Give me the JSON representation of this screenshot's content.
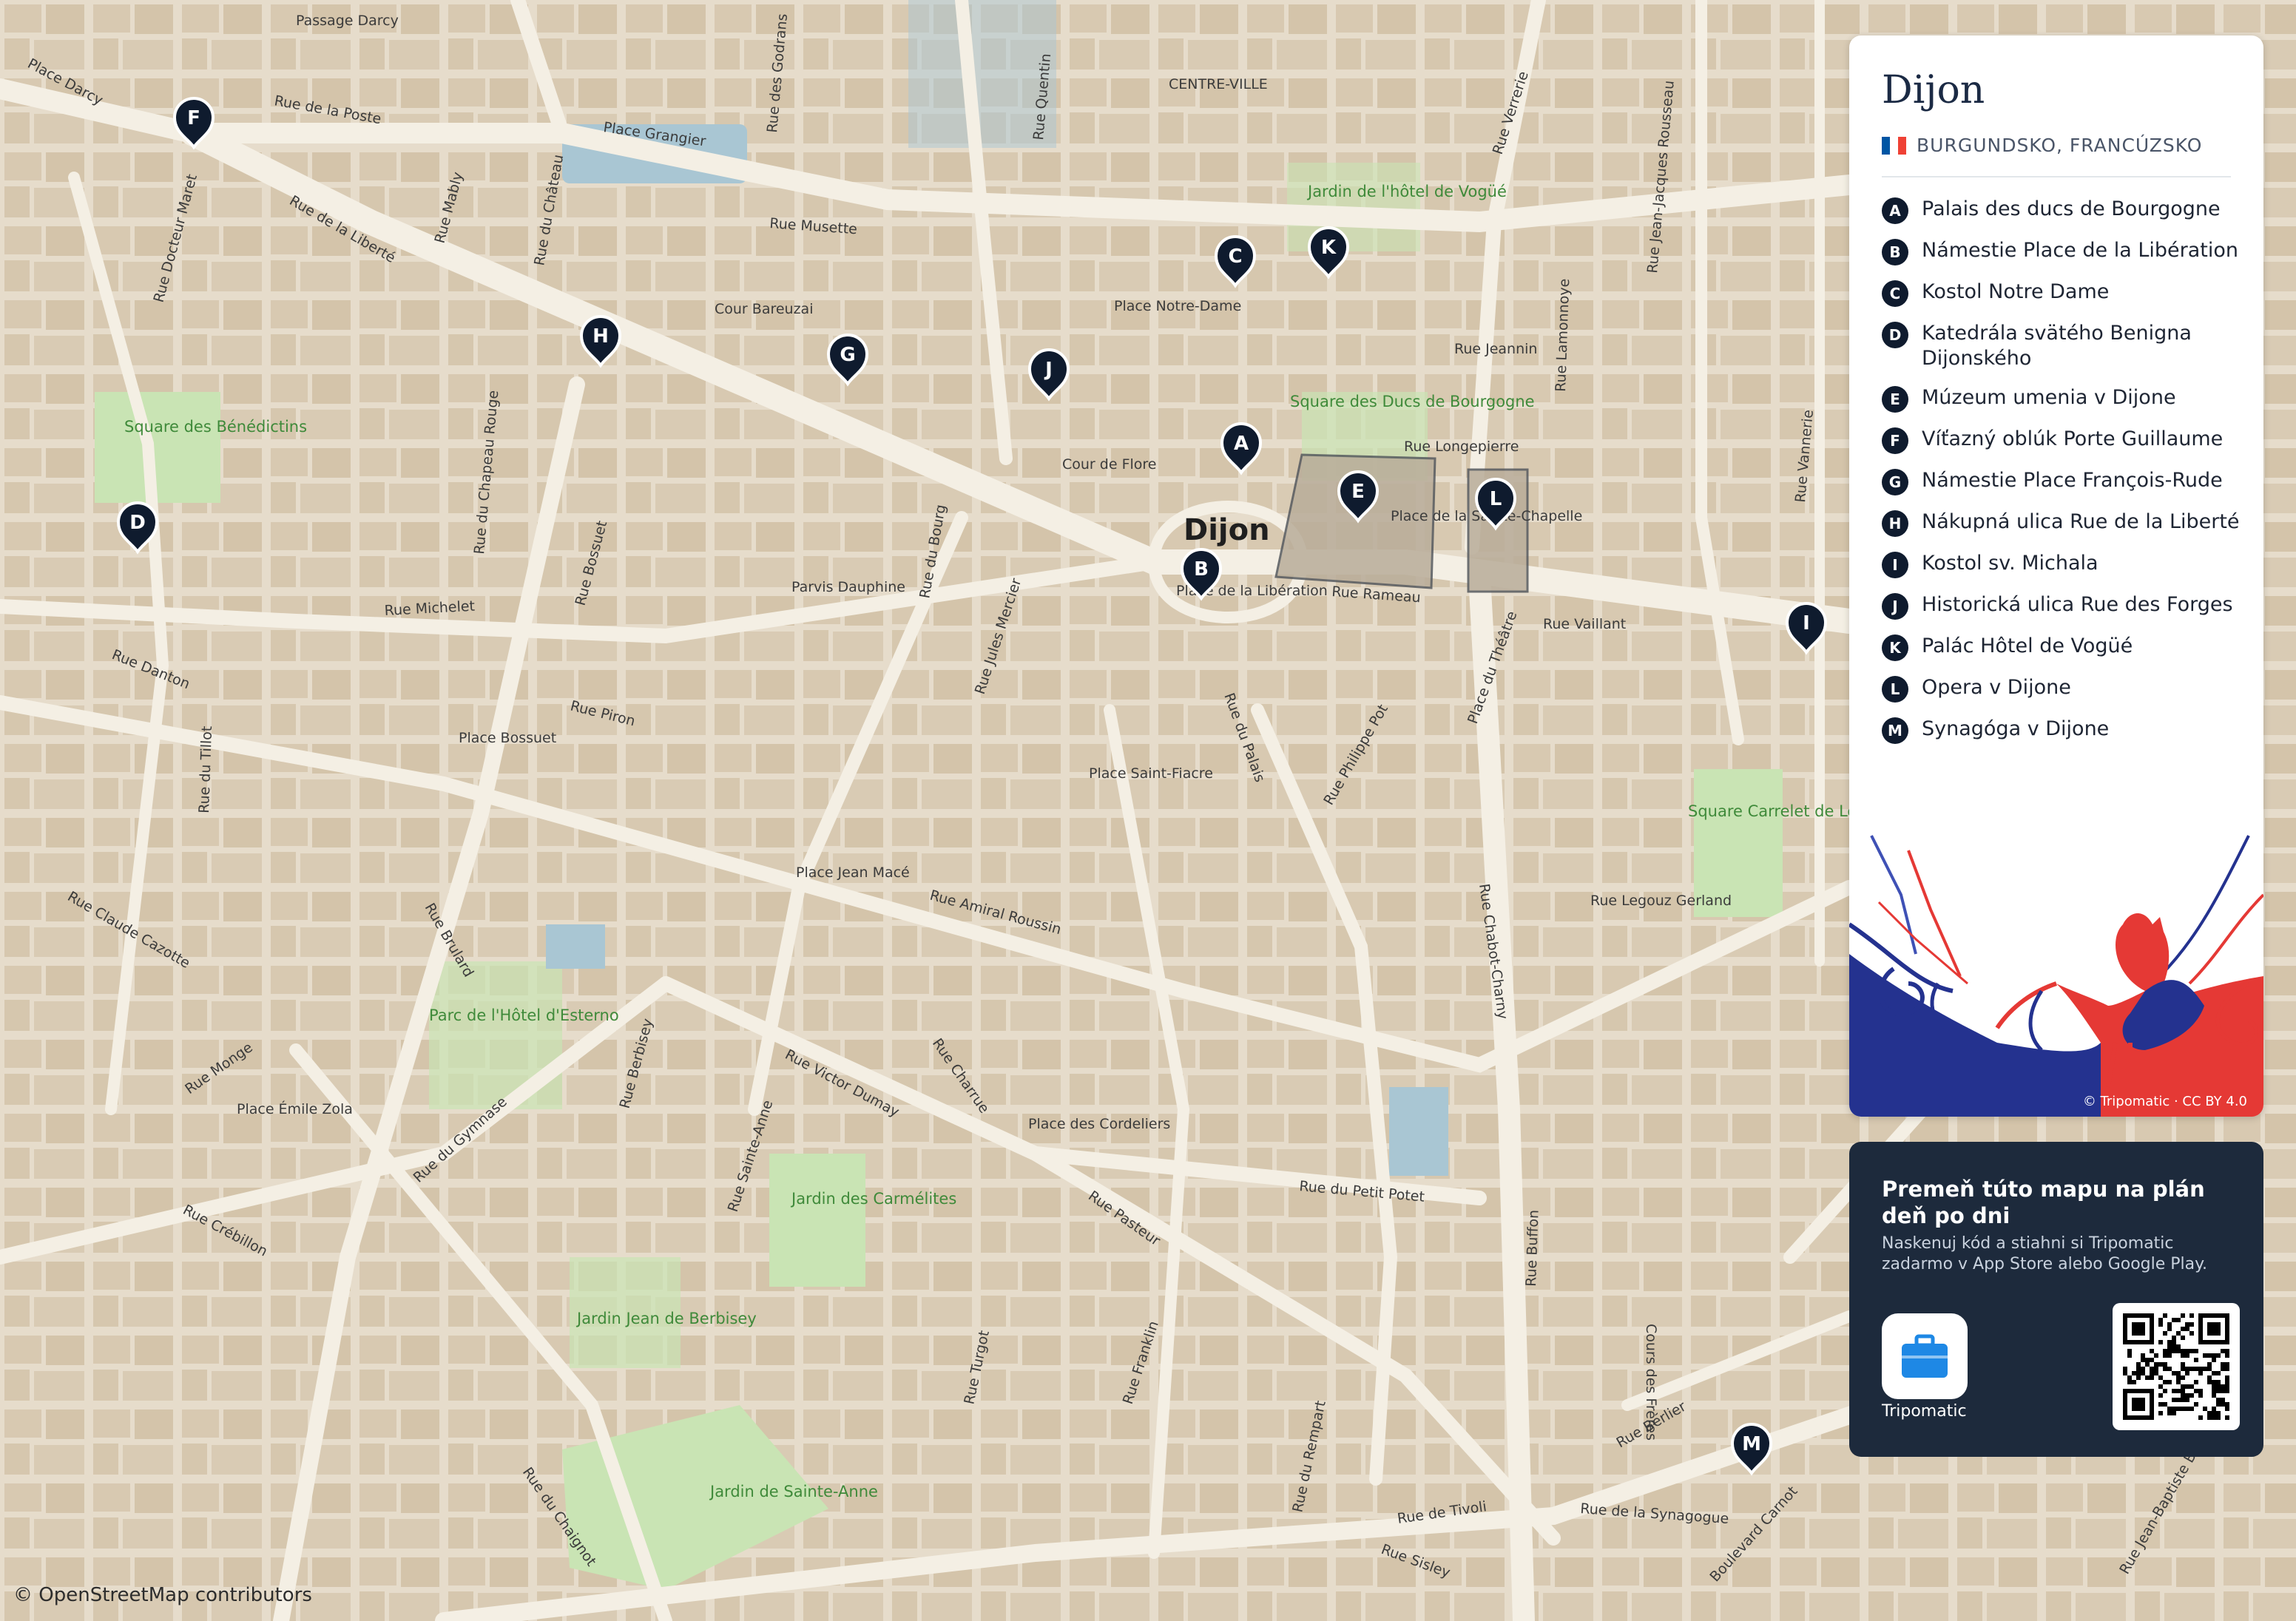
{
  "map": {
    "city_label": "Dijon",
    "district_label": "CENTRE-VILLE",
    "street_labels": [
      "Passage Darcy",
      "Place Darcy",
      "Rue de la Poste",
      "Place Grangier",
      "Rue des Godrans",
      "Rue Quentin",
      "Rue Verrerie",
      "Rue Jean-Jacques Rousseau",
      "Rue Docteur Maret",
      "Rue de la Liberté",
      "Rue Mably",
      "Rue du Château",
      "Rue Musette",
      "Cour Bareuzai",
      "Place Notre-Dame",
      "Rue Jeannin",
      "Rue Lamonnoye",
      "Rue Longepierre",
      "Cour de Flore",
      "Place de la Libération",
      "Place de la Sainte-Chapelle",
      "Rue Rameau",
      "Rue Vaillant",
      "Place du Théâtre",
      "Rue du Chapeau Rouge",
      "Rue Bossuet",
      "Rue Michelet",
      "Parvis Dauphine",
      "Rue du Bourg",
      "Rue Jules Mercier",
      "Rue Danton",
      "Rue Piron",
      "Place Bossuet",
      "Rue du Tillot",
      "Rue du Palais",
      "Rue Philippe Pot",
      "Place Saint-Fiacre",
      "Place Jean Macé",
      "Rue Amiral Roussin",
      "Rue Legouz Gerland",
      "Rue Chabot-Charny",
      "Rue Claude Cazotte",
      "Rue Brulard",
      "Rue Monge",
      "Place Émile Zola",
      "Rue Berbisey",
      "Rue Victor Dumay",
      "Rue Charrue",
      "Place des Cordeliers",
      "Rue du Gymnase",
      "Rue Crébillon",
      "Rue Sainte-Anne",
      "Rue du Petit Potet",
      "Rue Pasteur",
      "Rue Buffon",
      "Rue Turgot",
      "Rue Franklin",
      "Rue du Rempart",
      "Rue du Chaignot",
      "Rue de Tivoli",
      "Rue de la Synagogue",
      "Rue Sisley",
      "Rue Berlier",
      "Boulevard Carnot",
      "Rue Jean-Baptiste Baudin",
      "Rue Vannerie",
      "Cours des Frères"
    ],
    "park_labels": [
      "Jardin de l'hôtel de Vogüé",
      "Square des Ducs de Bourgogne",
      "Square des Bénédictins",
      "Square Carrelet de Loisy",
      "Parc de l'Hôtel d'Esterno",
      "Jardin des Carmélites",
      "Jardin Jean de Berbisey",
      "Jardin de Sainte-Anne"
    ],
    "pins": [
      "A",
      "B",
      "C",
      "D",
      "E",
      "F",
      "G",
      "H",
      "I",
      "J",
      "K",
      "L",
      "M"
    ],
    "attribution": "© OpenStreetMap contributors"
  },
  "panel": {
    "title": "Dijon",
    "subtitle": "BURGUNDSKO, FRANCÚZSKO",
    "flag_colors": [
      "#0055a4",
      "#ffffff",
      "#ef4135"
    ],
    "pois": [
      {
        "letter": "A",
        "name": "Palais des ducs de Bourgogne"
      },
      {
        "letter": "B",
        "name": "Námestie Place de la Libération"
      },
      {
        "letter": "C",
        "name": "Kostol Notre Dame"
      },
      {
        "letter": "D",
        "name": "Katedrála svätého Benigna Dijonského"
      },
      {
        "letter": "E",
        "name": "Múzeum umenia v Dijone"
      },
      {
        "letter": "F",
        "name": "Víťazný oblúk Porte Guillaume"
      },
      {
        "letter": "G",
        "name": "Námestie Place François-Rude"
      },
      {
        "letter": "H",
        "name": "Nákupná ulica Rue de la Liberté"
      },
      {
        "letter": "I",
        "name": "Kostol sv. Michala"
      },
      {
        "letter": "J",
        "name": "Historická ulica Rue des Forges"
      },
      {
        "letter": "K",
        "name": "Palác Hôtel de Vogüé"
      },
      {
        "letter": "L",
        "name": "Opera v Dijone"
      },
      {
        "letter": "M",
        "name": "Synagóga v Dijone"
      }
    ],
    "art_credit": "© Tripomatic · CC BY 4.0"
  },
  "promo": {
    "heading": "Premeň túto mapu na plán deň po dni",
    "text": "Naskenuj kód a stiahni si Tripomatic zadarmo v App Store alebo Google Play.",
    "app_name": "Tripomatic",
    "icon": "suitcase-icon"
  },
  "colors": {
    "map_bg": "#e8dfd0",
    "building": "#d9cbb4",
    "road": "#f5f0e6",
    "park": "#c9e6b5",
    "water": "#a9c6d3",
    "pin": "#0f1b2e",
    "panel_dark": "#1d2a3c"
  }
}
